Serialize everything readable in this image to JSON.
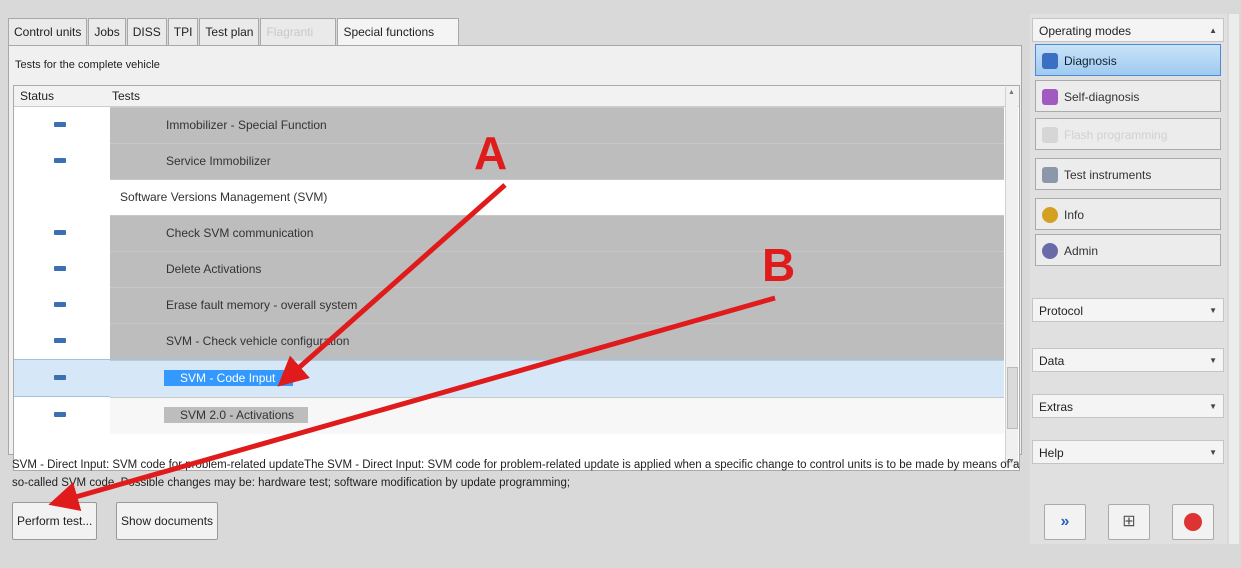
{
  "tabs": [
    {
      "label": "Control units",
      "state": "normal"
    },
    {
      "label": "Jobs",
      "state": "normal"
    },
    {
      "label": "DISS",
      "state": "normal"
    },
    {
      "label": "TPI",
      "state": "normal"
    },
    {
      "label": "Test plan",
      "state": "normal"
    },
    {
      "label": "Flagranti",
      "state": "disabled"
    },
    {
      "label": "Special functions",
      "state": "active"
    }
  ],
  "panel": {
    "caption": "Tests for the complete vehicle",
    "columns": {
      "status": "Status",
      "tests": "Tests"
    },
    "rows": [
      {
        "label": "Immobilizer - Special Function",
        "type": "test"
      },
      {
        "label": "Service Immobilizer",
        "type": "test"
      },
      {
        "label": "Software Versions Management (SVM)",
        "type": "group"
      },
      {
        "label": "Check SVM communication",
        "type": "test"
      },
      {
        "label": "Delete Activations",
        "type": "test"
      },
      {
        "label": "Erase fault memory - overall system",
        "type": "test"
      },
      {
        "label": "SVM - Check vehicle configuration",
        "type": "test"
      },
      {
        "label": "SVM - Code Input",
        "type": "selected"
      },
      {
        "label": "SVM 2.0 - Activations",
        "type": "activations"
      }
    ],
    "description": "SVM - Direct Input: SVM code for problem-related updateThe SVM - Direct Input: SVM code for problem-related update is applied when a specific change to control units is to be made by means of a so-called SVM code. Possible changes may be: hardware test; software modification by update programming;"
  },
  "buttons": {
    "perform_test": "Perform test...",
    "show_documents": "Show documents"
  },
  "sidebar": {
    "operating_modes_title": "Operating modes",
    "modes": [
      {
        "label": "Diagnosis",
        "state": "active",
        "icon": "stethoscope-icon",
        "color": "#3a6fc4"
      },
      {
        "label": "Self-diagnosis",
        "state": "normal",
        "icon": "book-icon",
        "color": "#a05ac0"
      },
      {
        "label": "Flash programming",
        "state": "disabled",
        "icon": "chip-icon",
        "color": "#c8c8c8"
      },
      {
        "label": "Test instruments",
        "state": "normal",
        "icon": "gauge-icon",
        "color": "#6a7a90"
      },
      {
        "label": "Info",
        "state": "normal",
        "icon": "info-icon",
        "color": "#d4a021"
      },
      {
        "label": "Admin",
        "state": "normal",
        "icon": "admin-icon",
        "color": "#6a6aa8"
      }
    ],
    "sections": [
      "Protocol",
      "Data",
      "Extras",
      "Help"
    ],
    "bottom_icons": [
      "forward-icon",
      "fullscreen-icon",
      "close-icon"
    ]
  },
  "annotations": {
    "a_label": "A",
    "b_label": "B",
    "arrow_color": "#e01b1b"
  },
  "colors": {
    "selection": "#3399ff",
    "status_dash": "#3d6fb3",
    "row_gray": "#bdbdbd"
  }
}
